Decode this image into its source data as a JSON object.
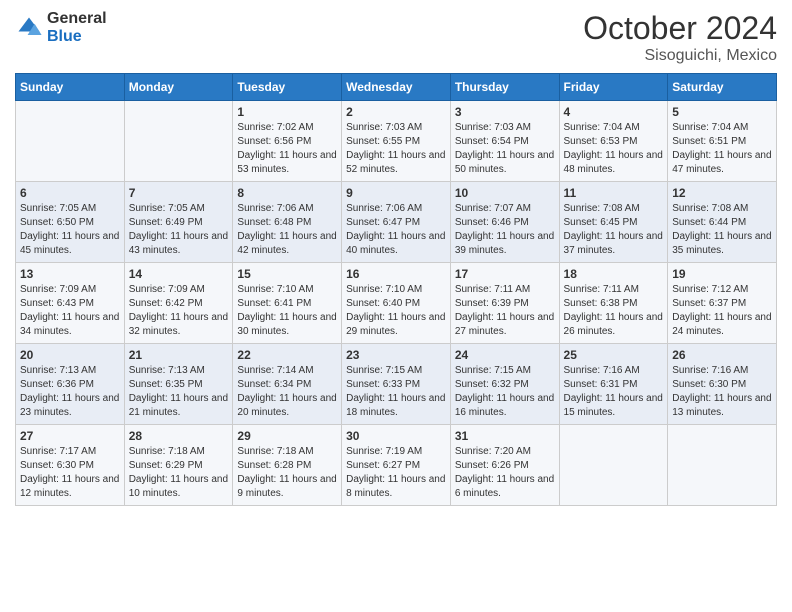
{
  "logo": {
    "general": "General",
    "blue": "Blue"
  },
  "title": {
    "month": "October 2024",
    "location": "Sisoguichi, Mexico"
  },
  "calendar": {
    "headers": [
      "Sunday",
      "Monday",
      "Tuesday",
      "Wednesday",
      "Thursday",
      "Friday",
      "Saturday"
    ],
    "weeks": [
      [
        {
          "day": "",
          "sunrise": "",
          "sunset": "",
          "daylight": ""
        },
        {
          "day": "",
          "sunrise": "",
          "sunset": "",
          "daylight": ""
        },
        {
          "day": "1",
          "sunrise": "Sunrise: 7:02 AM",
          "sunset": "Sunset: 6:56 PM",
          "daylight": "Daylight: 11 hours and 53 minutes."
        },
        {
          "day": "2",
          "sunrise": "Sunrise: 7:03 AM",
          "sunset": "Sunset: 6:55 PM",
          "daylight": "Daylight: 11 hours and 52 minutes."
        },
        {
          "day": "3",
          "sunrise": "Sunrise: 7:03 AM",
          "sunset": "Sunset: 6:54 PM",
          "daylight": "Daylight: 11 hours and 50 minutes."
        },
        {
          "day": "4",
          "sunrise": "Sunrise: 7:04 AM",
          "sunset": "Sunset: 6:53 PM",
          "daylight": "Daylight: 11 hours and 48 minutes."
        },
        {
          "day": "5",
          "sunrise": "Sunrise: 7:04 AM",
          "sunset": "Sunset: 6:51 PM",
          "daylight": "Daylight: 11 hours and 47 minutes."
        }
      ],
      [
        {
          "day": "6",
          "sunrise": "Sunrise: 7:05 AM",
          "sunset": "Sunset: 6:50 PM",
          "daylight": "Daylight: 11 hours and 45 minutes."
        },
        {
          "day": "7",
          "sunrise": "Sunrise: 7:05 AM",
          "sunset": "Sunset: 6:49 PM",
          "daylight": "Daylight: 11 hours and 43 minutes."
        },
        {
          "day": "8",
          "sunrise": "Sunrise: 7:06 AM",
          "sunset": "Sunset: 6:48 PM",
          "daylight": "Daylight: 11 hours and 42 minutes."
        },
        {
          "day": "9",
          "sunrise": "Sunrise: 7:06 AM",
          "sunset": "Sunset: 6:47 PM",
          "daylight": "Daylight: 11 hours and 40 minutes."
        },
        {
          "day": "10",
          "sunrise": "Sunrise: 7:07 AM",
          "sunset": "Sunset: 6:46 PM",
          "daylight": "Daylight: 11 hours and 39 minutes."
        },
        {
          "day": "11",
          "sunrise": "Sunrise: 7:08 AM",
          "sunset": "Sunset: 6:45 PM",
          "daylight": "Daylight: 11 hours and 37 minutes."
        },
        {
          "day": "12",
          "sunrise": "Sunrise: 7:08 AM",
          "sunset": "Sunset: 6:44 PM",
          "daylight": "Daylight: 11 hours and 35 minutes."
        }
      ],
      [
        {
          "day": "13",
          "sunrise": "Sunrise: 7:09 AM",
          "sunset": "Sunset: 6:43 PM",
          "daylight": "Daylight: 11 hours and 34 minutes."
        },
        {
          "day": "14",
          "sunrise": "Sunrise: 7:09 AM",
          "sunset": "Sunset: 6:42 PM",
          "daylight": "Daylight: 11 hours and 32 minutes."
        },
        {
          "day": "15",
          "sunrise": "Sunrise: 7:10 AM",
          "sunset": "Sunset: 6:41 PM",
          "daylight": "Daylight: 11 hours and 30 minutes."
        },
        {
          "day": "16",
          "sunrise": "Sunrise: 7:10 AM",
          "sunset": "Sunset: 6:40 PM",
          "daylight": "Daylight: 11 hours and 29 minutes."
        },
        {
          "day": "17",
          "sunrise": "Sunrise: 7:11 AM",
          "sunset": "Sunset: 6:39 PM",
          "daylight": "Daylight: 11 hours and 27 minutes."
        },
        {
          "day": "18",
          "sunrise": "Sunrise: 7:11 AM",
          "sunset": "Sunset: 6:38 PM",
          "daylight": "Daylight: 11 hours and 26 minutes."
        },
        {
          "day": "19",
          "sunrise": "Sunrise: 7:12 AM",
          "sunset": "Sunset: 6:37 PM",
          "daylight": "Daylight: 11 hours and 24 minutes."
        }
      ],
      [
        {
          "day": "20",
          "sunrise": "Sunrise: 7:13 AM",
          "sunset": "Sunset: 6:36 PM",
          "daylight": "Daylight: 11 hours and 23 minutes."
        },
        {
          "day": "21",
          "sunrise": "Sunrise: 7:13 AM",
          "sunset": "Sunset: 6:35 PM",
          "daylight": "Daylight: 11 hours and 21 minutes."
        },
        {
          "day": "22",
          "sunrise": "Sunrise: 7:14 AM",
          "sunset": "Sunset: 6:34 PM",
          "daylight": "Daylight: 11 hours and 20 minutes."
        },
        {
          "day": "23",
          "sunrise": "Sunrise: 7:15 AM",
          "sunset": "Sunset: 6:33 PM",
          "daylight": "Daylight: 11 hours and 18 minutes."
        },
        {
          "day": "24",
          "sunrise": "Sunrise: 7:15 AM",
          "sunset": "Sunset: 6:32 PM",
          "daylight": "Daylight: 11 hours and 16 minutes."
        },
        {
          "day": "25",
          "sunrise": "Sunrise: 7:16 AM",
          "sunset": "Sunset: 6:31 PM",
          "daylight": "Daylight: 11 hours and 15 minutes."
        },
        {
          "day": "26",
          "sunrise": "Sunrise: 7:16 AM",
          "sunset": "Sunset: 6:30 PM",
          "daylight": "Daylight: 11 hours and 13 minutes."
        }
      ],
      [
        {
          "day": "27",
          "sunrise": "Sunrise: 7:17 AM",
          "sunset": "Sunset: 6:30 PM",
          "daylight": "Daylight: 11 hours and 12 minutes."
        },
        {
          "day": "28",
          "sunrise": "Sunrise: 7:18 AM",
          "sunset": "Sunset: 6:29 PM",
          "daylight": "Daylight: 11 hours and 10 minutes."
        },
        {
          "day": "29",
          "sunrise": "Sunrise: 7:18 AM",
          "sunset": "Sunset: 6:28 PM",
          "daylight": "Daylight: 11 hours and 9 minutes."
        },
        {
          "day": "30",
          "sunrise": "Sunrise: 7:19 AM",
          "sunset": "Sunset: 6:27 PM",
          "daylight": "Daylight: 11 hours and 8 minutes."
        },
        {
          "day": "31",
          "sunrise": "Sunrise: 7:20 AM",
          "sunset": "Sunset: 6:26 PM",
          "daylight": "Daylight: 11 hours and 6 minutes."
        },
        {
          "day": "",
          "sunrise": "",
          "sunset": "",
          "daylight": ""
        },
        {
          "day": "",
          "sunrise": "",
          "sunset": "",
          "daylight": ""
        }
      ]
    ]
  }
}
